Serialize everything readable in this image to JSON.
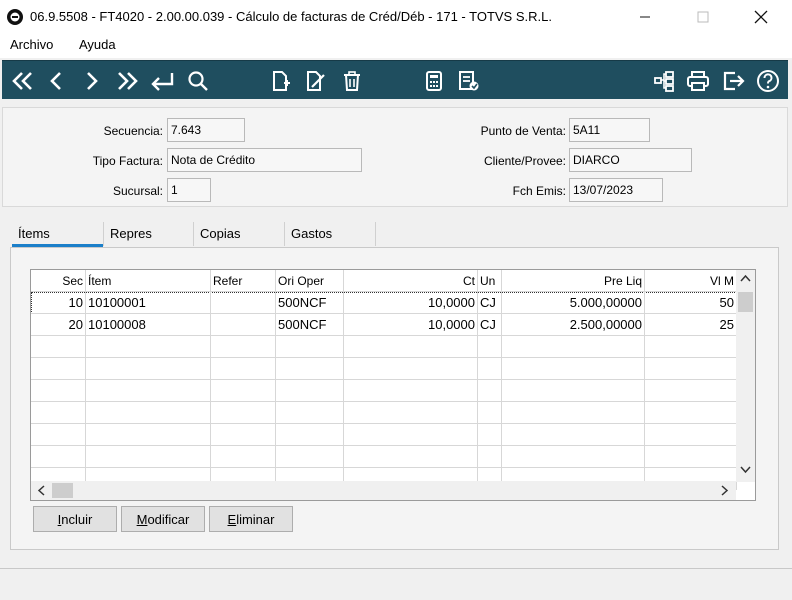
{
  "window": {
    "title": "06.9.5508 - FT4020 - 2.00.00.039 - Cálculo de facturas de Créd/Déb - 171 - TOTVS S.R.L."
  },
  "menu": {
    "items": [
      "Archivo",
      "Ayuda"
    ]
  },
  "toolbar": {
    "left_icons": [
      "first-record-icon",
      "previous-record-icon",
      "next-record-icon",
      "last-record-icon",
      "return-icon",
      "search-icon"
    ],
    "mid_icons": [
      "new-document-icon",
      "edit-document-icon",
      "delete-icon",
      "calculator-icon",
      "list-check-icon"
    ],
    "right_icons": [
      "tree-structure-icon",
      "print-icon",
      "exit-icon",
      "help-icon"
    ],
    "colors": {
      "background": "#1f4e5f",
      "icon": "#ffffff"
    }
  },
  "header": {
    "secuencia": {
      "label": "Secuencia:",
      "value": "7.643"
    },
    "tipo_factura": {
      "label": "Tipo Factura:",
      "value": "Nota de Crédito"
    },
    "sucursal": {
      "label": "Sucursal:",
      "value": "1"
    },
    "punto_venta": {
      "label": "Punto de Venta:",
      "value": "5A11"
    },
    "cliente": {
      "label": "Cliente/Provee:",
      "value": "DIARCO"
    },
    "fch_emis": {
      "label": "Fch Emis:",
      "value": "13/07/2023"
    }
  },
  "tabs": [
    {
      "label": "Ítems",
      "active": true
    },
    {
      "label": "Repres"
    },
    {
      "label": "Copias"
    },
    {
      "label": "Gastos"
    }
  ],
  "grid": {
    "columns": [
      "Sec",
      "Ítem",
      "Refer",
      "Ori Oper",
      "Ct",
      "Un",
      "Pre Liq",
      "Vl M"
    ],
    "rows": [
      [
        "10",
        "10100001",
        "",
        "500NCF",
        "10,0000",
        "CJ",
        "5.000,00000",
        "50"
      ],
      [
        "20",
        "10100008",
        "",
        "500NCF",
        "10,0000",
        "CJ",
        "2.500,00000",
        "25"
      ]
    ]
  },
  "buttons": {
    "incluir": {
      "u": "I",
      "rest": "ncluir"
    },
    "modificar": {
      "u": "M",
      "rest": "odificar"
    },
    "eliminar": {
      "u": "E",
      "rest": "liminar"
    }
  },
  "colors": {
    "accent": "#1b7fc9"
  }
}
